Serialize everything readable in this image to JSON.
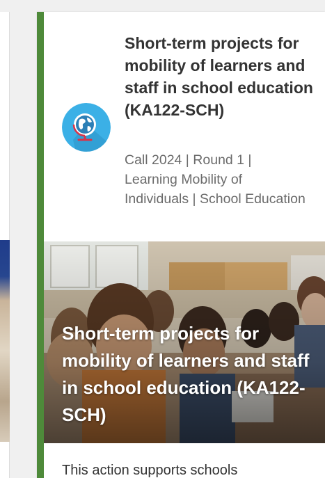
{
  "card": {
    "title": "Short-term projects for mobility of learners and staff in school education (KA122-SCH)",
    "meta": "Call 2024 | Round 1 | Learning Mobility of Individuals | School Education",
    "image_title": "Short-term projects for mobility of learners and staff in school education (KA122-SCH)",
    "description": "This action supports schools",
    "icon": "globe-icon",
    "accent_color": "#4e8a3a",
    "icon_color": "#3bb0e6"
  }
}
